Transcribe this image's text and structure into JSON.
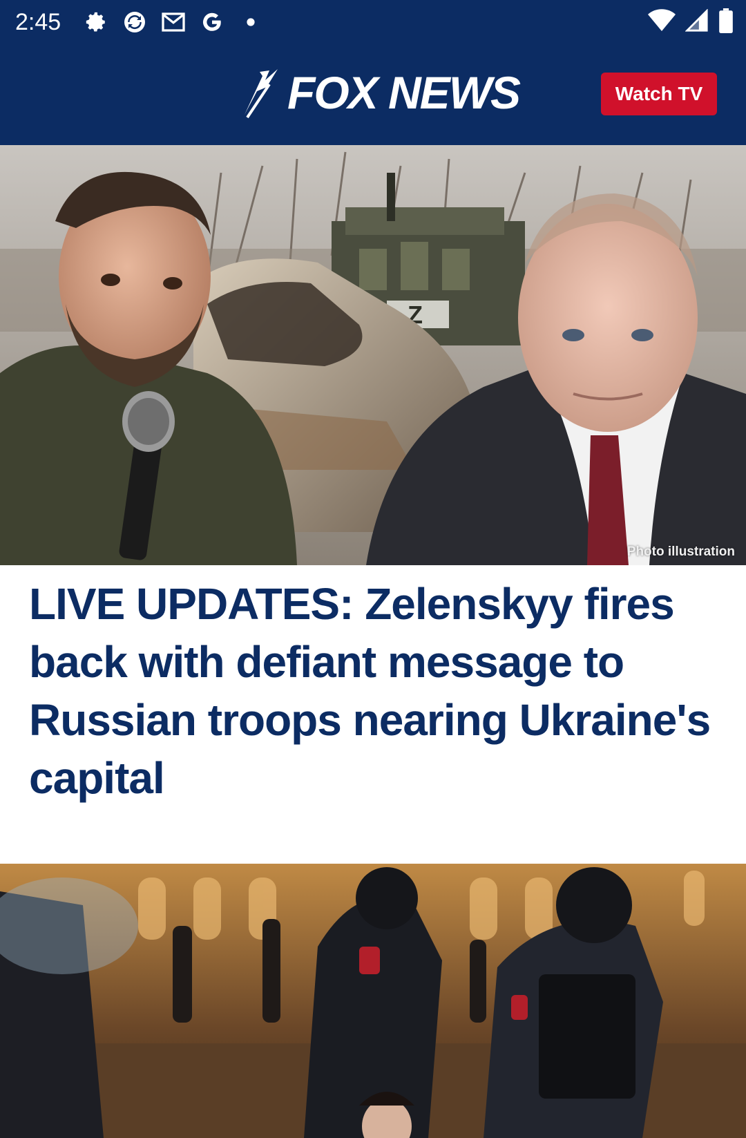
{
  "status_bar": {
    "time": "2:45",
    "left_icons": [
      "settings-icon",
      "sync-icon",
      "gmail-icon",
      "google-icon",
      "dot-icon"
    ],
    "right_icons": [
      "wifi-icon",
      "signal-icon",
      "battery-icon"
    ]
  },
  "header": {
    "logo_text": "FOX NEWS",
    "watch_tv_label": "Watch TV"
  },
  "hero": {
    "photo_credit": "Photo illustration"
  },
  "headline": {
    "text": "LIVE UPDATES: Zelenskyy fires back with defiant message to Russian troops nearing Ukraine's capital"
  },
  "colors": {
    "brand_navy": "#0c2c63",
    "watch_tv_red": "#d0112b",
    "headline_navy": "#0c2c63"
  }
}
